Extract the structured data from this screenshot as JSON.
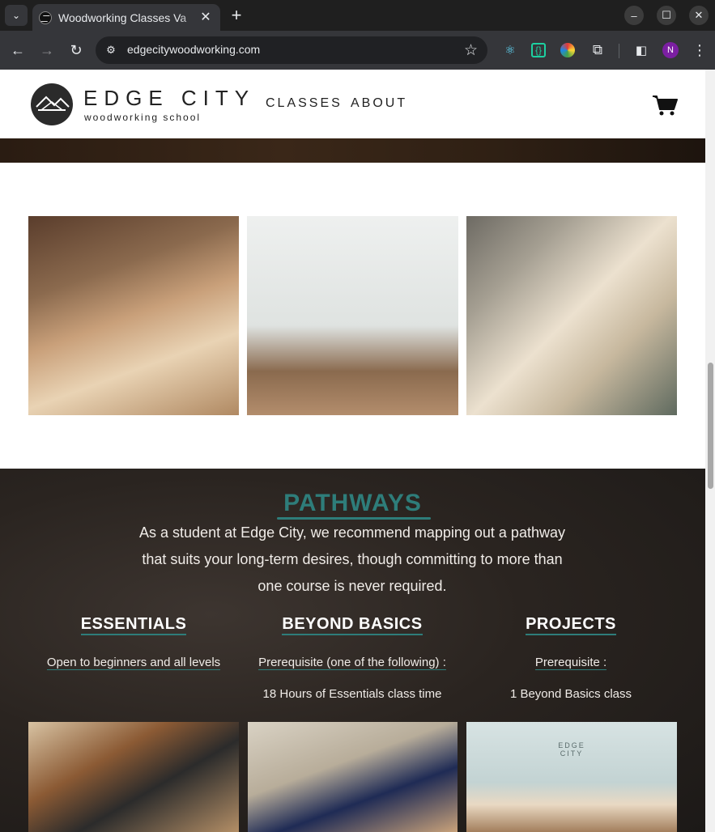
{
  "browser": {
    "tab_title": "Woodworking Classes Va",
    "url": "edgecitywoodworking.com",
    "profile_initial": "N"
  },
  "site": {
    "logo_text": "EDGE CITY",
    "logo_sub": "woodworking school",
    "nav": [
      "CLASSES",
      "ABOUT"
    ]
  },
  "pathways": {
    "title": "PATHWAYS",
    "intro": "As a student at Edge City, we recommend mapping out a pathway that suits your long-term desires, though committing to more than one course is never required.",
    "columns": [
      {
        "title": "ESSENTIALS",
        "link": "Open to beginners and all levels",
        "requirement": ""
      },
      {
        "title": "BEYOND BASICS",
        "link": "Prerequisite (one of the following) :",
        "requirement": "18 Hours of Essentials class time"
      },
      {
        "title": "PROJECTS",
        "link": "Prerequisite :",
        "requirement": "1 Beyond Basics class"
      }
    ]
  },
  "photo_sign": "EDGE CITY",
  "colors": {
    "accent": "#2e7d7a",
    "chrome_bg": "#35363a"
  }
}
